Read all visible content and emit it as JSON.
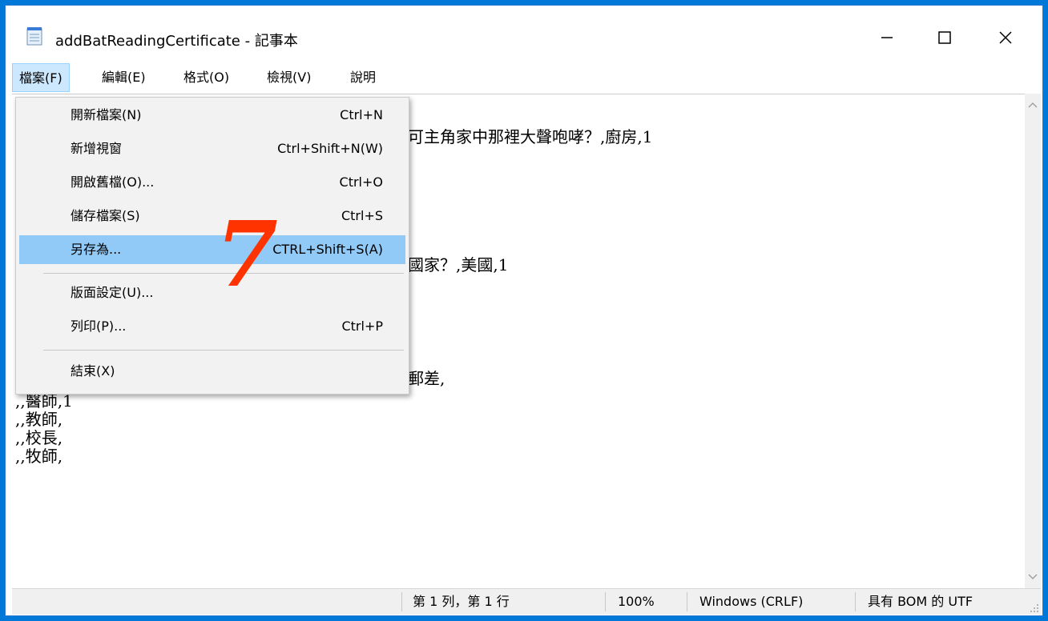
{
  "window": {
    "title": "addBatReadingCertificate - 記事本",
    "minimize_glyph": "—",
    "maximize_glyph": "☐",
    "close_glyph": "✕"
  },
  "menubar": {
    "items": [
      {
        "label": "檔案(F)"
      },
      {
        "label": "編輯(E)"
      },
      {
        "label": "格式(O)"
      },
      {
        "label": "檢視(V)"
      },
      {
        "label": "說明"
      }
    ]
  },
  "file_menu": {
    "items": [
      {
        "label": "開新檔案(N)",
        "shortcut": "Ctrl+N"
      },
      {
        "label": "新增視窗",
        "shortcut": "Ctrl+Shift+N(W)"
      },
      {
        "label": "開啟舊檔(O)...",
        "shortcut": "Ctrl+O"
      },
      {
        "label": "儲存檔案(S)",
        "shortcut": "Ctrl+S"
      },
      {
        "label": "另存為...",
        "shortcut": "CTRL+Shift+S(A)"
      },
      {
        "label": "版面設定(U)...",
        "shortcut": ""
      },
      {
        "label": "列印(P)...",
        "shortcut": "Ctrl+P"
      },
      {
        "label": "結束(X)",
        "shortcut": ""
      }
    ]
  },
  "editor": {
    "visible_fragments": [
      "可主角家中那裡大聲咆哮？,廚房,1",
      "國家？,美國,1",
      "郵差,",
      ",,醫師,1",
      ",,教師,",
      ",,校長,",
      ",,牧師,"
    ]
  },
  "annotation": {
    "step_number": "7"
  },
  "statusbar": {
    "position": "第 1 列，第 1 行",
    "zoom": "100%",
    "line_ending": "Windows (CRLF)",
    "encoding": "具有 BOM 的 UTF"
  },
  "colors": {
    "accent_frame": "#0078d7",
    "menu_hover": "#91c9f7",
    "annotation": "#ff3300"
  }
}
